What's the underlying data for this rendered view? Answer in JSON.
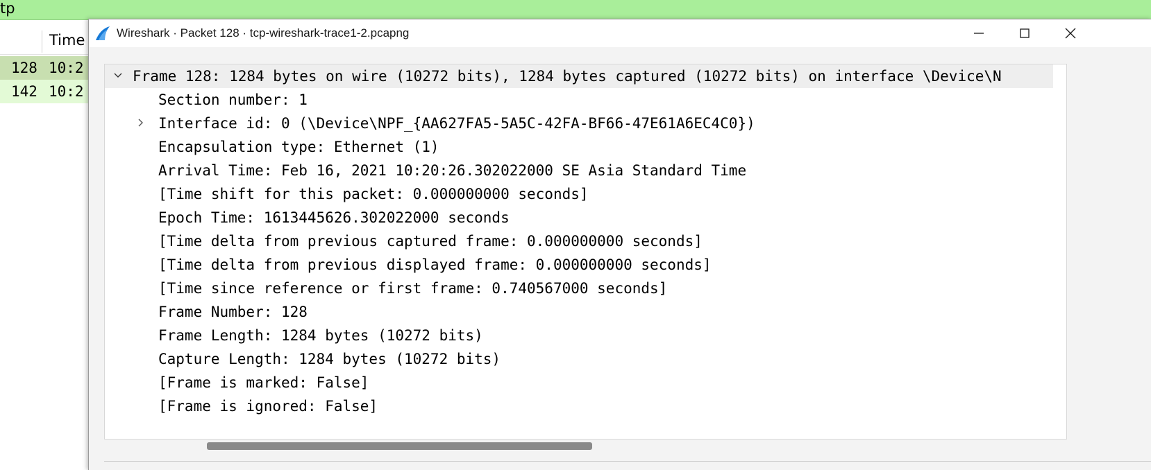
{
  "filter_bar": {
    "text": "tp"
  },
  "packet_list": {
    "column_header": "Time",
    "rows": [
      {
        "no": "128",
        "time": "10:2"
      },
      {
        "no": "142",
        "time": "10:2"
      }
    ]
  },
  "dialog": {
    "title": "Wireshark · Packet 128 · tcp-wireshark-trace1-2.pcapng",
    "tree": {
      "frame_summary": "Frame 128: 1284 bytes on wire (10272 bits), 1284 bytes captured (10272 bits) on interface \\Device\\N",
      "fields": [
        {
          "text": "Section number: 1",
          "expandable": false
        },
        {
          "text": "Interface id: 0 (\\Device\\NPF_{AA627FA5-5A5C-42FA-BF66-47E61A6EC4C0})",
          "expandable": true
        },
        {
          "text": "Encapsulation type: Ethernet (1)",
          "expandable": false
        },
        {
          "text": "Arrival Time: Feb 16, 2021 10:20:26.302022000 SE Asia Standard Time",
          "expandable": false
        },
        {
          "text": "[Time shift for this packet: 0.000000000 seconds]",
          "expandable": false
        },
        {
          "text": "Epoch Time: 1613445626.302022000 seconds",
          "expandable": false
        },
        {
          "text": "[Time delta from previous captured frame: 0.000000000 seconds]",
          "expandable": false
        },
        {
          "text": "[Time delta from previous displayed frame: 0.000000000 seconds]",
          "expandable": false
        },
        {
          "text": "[Time since reference or first frame: 0.740567000 seconds]",
          "expandable": false
        },
        {
          "text": "Frame Number: 128",
          "expandable": false
        },
        {
          "text": "Frame Length: 1284 bytes (10272 bits)",
          "expandable": false
        },
        {
          "text": "Capture Length: 1284 bytes (10272 bits)",
          "expandable": false
        },
        {
          "text": "[Frame is marked: False]",
          "expandable": false
        },
        {
          "text": "[Frame is ignored: False]",
          "expandable": false
        }
      ]
    }
  },
  "icons": {
    "app": "wireshark-fin-icon",
    "minimize": "minimize-icon",
    "maximize": "maximize-icon",
    "close": "close-icon",
    "expanded": "chevron-down-icon",
    "collapsed": "chevron-right-icon"
  },
  "colors": {
    "filter_bar_bg": "#a9ee9a",
    "row_selected_bg": "#c8dfb0",
    "row_bg": "#e3fad6",
    "app_icon_blue": "#1679d6"
  }
}
